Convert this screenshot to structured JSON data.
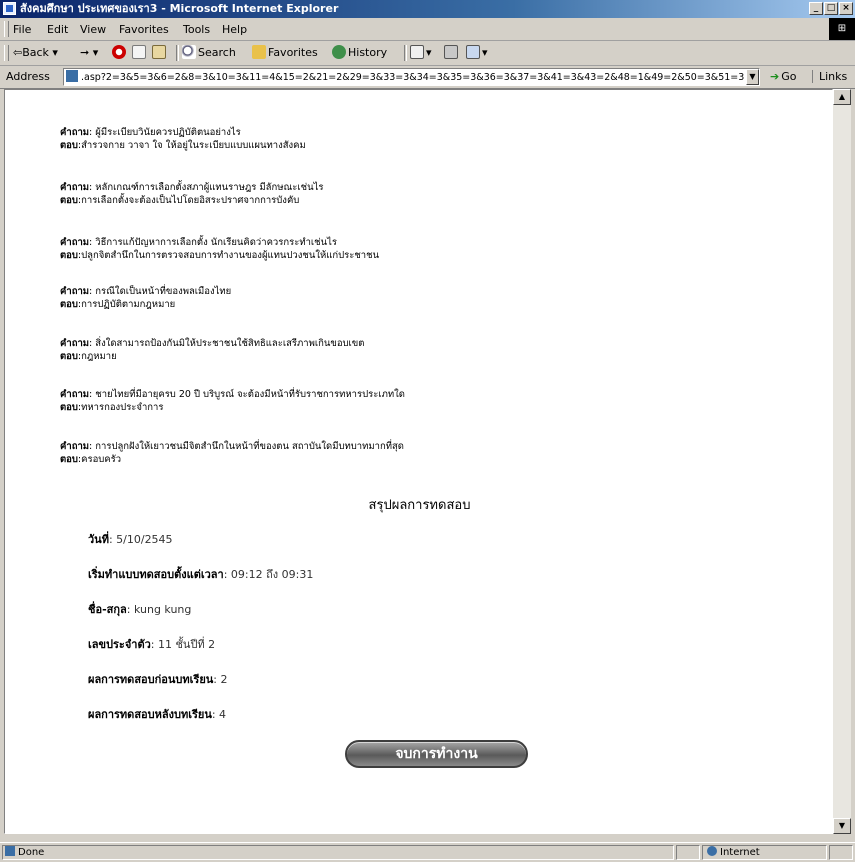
{
  "window": {
    "title": "สังคมศึกษา ประเทศของเรา3 - Microsoft Internet Explorer",
    "controls": {
      "minimize": "_",
      "restore": "□",
      "close": "×"
    }
  },
  "menu": [
    "File",
    "Edit",
    "View",
    "Favorites",
    "Tools",
    "Help"
  ],
  "toolbar": {
    "back": "Back",
    "search": "Search",
    "favorites": "Favorites",
    "history": "History"
  },
  "address": {
    "label": "Address",
    "url": ".asp?2=3&5=3&6=2&8=3&10=3&11=4&15=2&21=2&29=3&33=3&34=3&35=3&36=3&37=3&41=3&43=2&48=1&49=2&50=3&51=3",
    "go": "Go",
    "links": "Links"
  },
  "qa_items": [
    {
      "q_label": "คำถาม",
      "question": ": ผู้มีระเบียบวินัยควรปฏิบัติตนอย่างไร",
      "a_label": "ตอบ",
      "answer": ":สำรวจกาย วาจา ใจ ให้อยู่ในระเบียบแบบแผนทางสังคม"
    },
    {
      "q_label": "คำถาม",
      "question": ": หลักเกณฑ์การเลือกตั้งสภาผู้แทนราษฎร มีลักษณะเช่นไร",
      "a_label": "ตอบ",
      "answer": ":การเลือกตั้งจะต้องเป็นไปโดยอิสระปราศจากการบังคับ"
    },
    {
      "q_label": "คำถาม",
      "question": ": วิธีการแก้ปัญหาการเลือกตั้ง นักเรียนคิดว่าควรกระทำเช่นไร",
      "a_label": "ตอบ",
      "answer": ":ปลูกจิตสำนึกในการตรวจสอบการทำงานของผู้แทนปวงชนให้แก่ประชาชน"
    },
    {
      "q_label": "คำถาม",
      "question": ": กรณีใดเป็นหน้าที่ของพลเมืองไทย",
      "a_label": "ตอบ",
      "answer": ":การปฏิบัติตามกฎหมาย"
    },
    {
      "q_label": "คำถาม",
      "question": ": สิ่งใดสามารถป้องกันมิให้ประชาชนใช้สิทธิและเสรีภาพเกินขอบเขต",
      "a_label": "ตอบ",
      "answer": ":กฎหมาย"
    },
    {
      "q_label": "คำถาม",
      "question": ": ชายไทยที่มีอายุครบ 20 ปี บริบูรณ์ จะต้องมีหน้าที่รับราชการทหารประเภทใด",
      "a_label": "ตอบ",
      "answer": ":ทหารกองประจำการ"
    },
    {
      "q_label": "คำถาม",
      "question": ": การปลูกฝังให้เยาวชนมีจิตสำนึกในหน้าที่ของตน สถาบันใดมีบทบาทมากที่สุด",
      "a_label": "ตอบ",
      "answer": ":ครอบครัว"
    }
  ],
  "summary": {
    "title": "สรุปผลการทดสอบ",
    "rows": [
      {
        "label": "วันที่",
        "value": ": 5/10/2545"
      },
      {
        "label": "เริ่มทำแบบทดสอบตั้งแต่เวลา",
        "value": ": 09:12 ถึง 09:31"
      },
      {
        "label": "ชื่อ-สกุล",
        "value": ": kung  kung"
      },
      {
        "label": "เลขประจำตัว",
        "value": ": 11 ชั้นปีที่ 2"
      },
      {
        "label": "ผลการทดสอบก่อนบทเรียน",
        "value": ": 2"
      },
      {
        "label": "ผลการทดสอบหลังบทเรียน",
        "value": ": 4"
      }
    ],
    "end_button": "จบการทำงาน"
  },
  "status": {
    "left": "Done",
    "zone": "Internet"
  }
}
